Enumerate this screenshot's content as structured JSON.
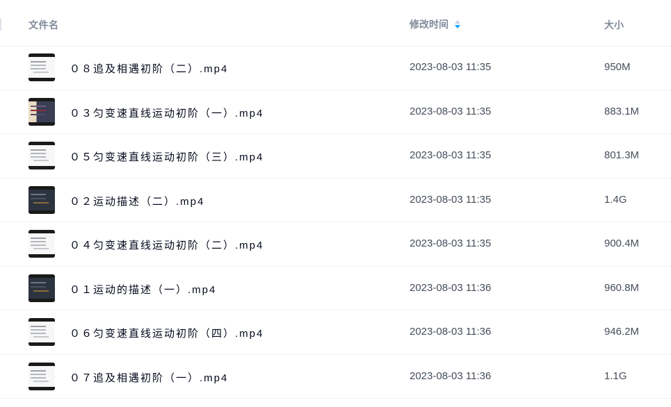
{
  "header": {
    "name_label": "文件名",
    "time_label": "修改时间",
    "size_label": "大小",
    "sort_icon": "sort-desc-icon",
    "accent_color": "#06a7ff"
  },
  "files": [
    {
      "name": "０８追及相遇初阶（二）.mp4",
      "time": "2023-08-03 11:35",
      "size": "950M",
      "thumb": "video-thumbnail-light"
    },
    {
      "name": "０３匀变速直线运动初阶（一）.mp4",
      "time": "2023-08-03 11:35",
      "size": "883.1M",
      "thumb": "video-thumbnail-mixed"
    },
    {
      "name": "０５匀变速直线运动初阶（三）.mp4",
      "time": "2023-08-03 11:35",
      "size": "801.3M",
      "thumb": "video-thumbnail-light"
    },
    {
      "name": "０２运动描述（二）.mp4",
      "time": "2023-08-03 11:35",
      "size": "1.4G",
      "thumb": "video-thumbnail-dark"
    },
    {
      "name": "０４匀变速直线运动初阶（二）.mp4",
      "time": "2023-08-03 11:35",
      "size": "900.4M",
      "thumb": "video-thumbnail-light"
    },
    {
      "name": "０１运动的描述（一）.mp4",
      "time": "2023-08-03 11:36",
      "size": "960.8M",
      "thumb": "video-thumbnail-dark"
    },
    {
      "name": "０６匀变速直线运动初阶（四）.mp4",
      "time": "2023-08-03 11:36",
      "size": "946.2M",
      "thumb": "video-thumbnail-light"
    },
    {
      "name": "０７追及相遇初阶（一）.mp4",
      "time": "2023-08-03 11:36",
      "size": "1.1G",
      "thumb": "video-thumbnail-light"
    }
  ]
}
